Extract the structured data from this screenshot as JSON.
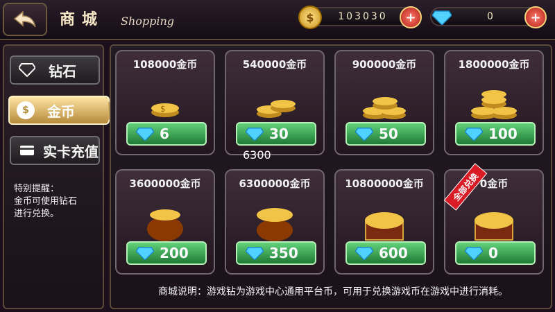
{
  "header": {
    "title": "商城",
    "subtitle": "Shopping",
    "back_icon": "back-arrow-icon",
    "gold": {
      "value": "103030",
      "icon": "coin-icon"
    },
    "diamond": {
      "value": "0",
      "icon": "diamond-icon"
    }
  },
  "sidebar": {
    "items": [
      {
        "label": "钻石",
        "icon": "diamond-icon"
      },
      {
        "label": "金币",
        "icon": "dollar-coin-icon"
      },
      {
        "label": "实卡充值",
        "icon": "card-icon"
      }
    ],
    "hint": "特别提醒：\n金币可使用钻石\n进行兑换。"
  },
  "products": [
    {
      "name": "108000金币",
      "price": "6"
    },
    {
      "name": "540000金币",
      "price": "30"
    },
    {
      "name": "900000金币",
      "price": "50"
    },
    {
      "name": "1800000金币",
      "price": "100"
    },
    {
      "name": "3600000金币",
      "price": "200"
    },
    {
      "name": "6300000金币",
      "price": "350"
    },
    {
      "name": "10800000金币",
      "price": "600"
    },
    {
      "name": "0金币",
      "price": "0",
      "badge": "全部兑换"
    }
  ],
  "overlay_value": "6300",
  "footer": "商城说明：游戏钻为游戏中心通用平台币，可用于兑换游戏币在游戏中进行消耗。",
  "colors": {
    "accent": "#1f7a34",
    "gold": "#f0c14b"
  }
}
